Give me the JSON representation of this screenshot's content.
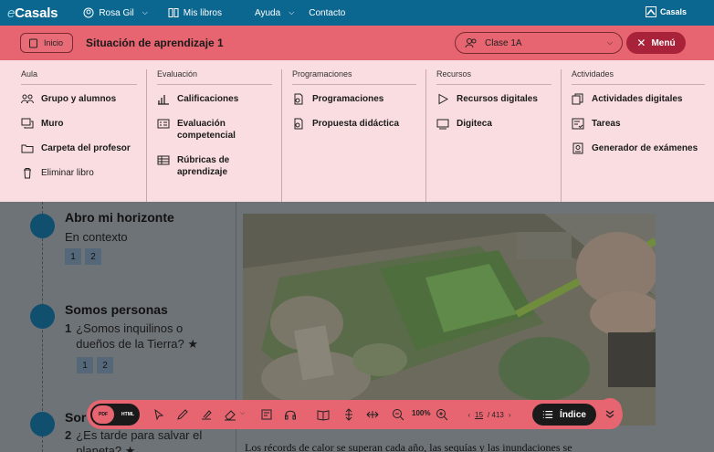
{
  "topbar": {
    "brand_prefix": "e",
    "brand_name": "Casals",
    "user": "Rosa Gil",
    "my_books": "Mis libros",
    "help": "Ayuda",
    "contact": "Contacto",
    "right_logo": "Casals"
  },
  "context": {
    "home_label": "Inicio",
    "title": "Situación de aprendizaje 1",
    "class_select": "Clase 1A",
    "menu_label": "Menú"
  },
  "mega_menu": {
    "aula": {
      "heading": "Aula",
      "items": [
        "Grupo y alumnos",
        "Muro",
        "Carpeta del profesor",
        "Eliminar libro"
      ]
    },
    "evaluacion": {
      "heading": "Evaluación",
      "items": [
        "Calificaciones",
        "Evaluación competencial",
        "Rúbricas de aprendizaje"
      ]
    },
    "programaciones": {
      "heading": "Programaciones",
      "items": [
        "Programaciones",
        "Propuesta didáctica"
      ]
    },
    "recursos": {
      "heading": "Recursos",
      "items": [
        "Recursos digitales",
        "Digiteca"
      ]
    },
    "actividades": {
      "heading": "Actividades",
      "items": [
        "Actividades digitales",
        "Tareas",
        "Generador de exámenes"
      ]
    }
  },
  "content": {
    "sections": [
      {
        "title": "Abro mi horizonte",
        "subtitle": "En contexto",
        "pages": [
          "1",
          "2"
        ]
      },
      {
        "title": "Somos personas",
        "number": "1",
        "subtitle": "¿Somos inquilinos o dueños de la Tierra? ★",
        "pages": [
          "1",
          "2"
        ]
      },
      {
        "title": "Sor",
        "number": "2",
        "subtitle": "¿Es tarde para salvar el planeta? ★"
      }
    ],
    "bottom_text": "Los récords de calor se superan cada año, las sequías y las inundaciones se"
  },
  "toolbar": {
    "format_pdf": "PDF",
    "format_html": "HTML",
    "zoom": "100%",
    "current_page": "15",
    "total_pages": "/ 413",
    "index_label": "Índice"
  },
  "colors": {
    "topbar": "#0c6790",
    "accent": "#e76570",
    "menu_button": "#a8233a",
    "mega_bg": "#f9dde0",
    "timeline_dot": "#104f6e"
  }
}
